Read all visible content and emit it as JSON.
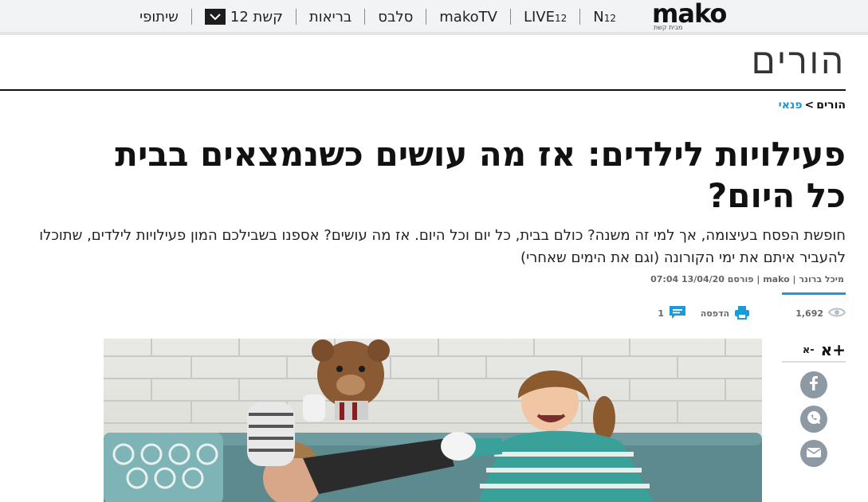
{
  "nav": {
    "logo_text": "mako",
    "logo_sub": "מבית קשת",
    "items": [
      {
        "label": "N",
        "sup": "12"
      },
      {
        "label": "LIVE",
        "sup": "12"
      },
      {
        "label": "makoTV"
      },
      {
        "label": "סלבס"
      },
      {
        "label": "בריאות"
      },
      {
        "label": "קשת 12"
      },
      {
        "label": "שיתופי"
      }
    ]
  },
  "section": {
    "title": "הורים"
  },
  "breadcrumb": {
    "root": "הורים",
    "separator": ">",
    "current": "פנאי"
  },
  "article": {
    "headline": "פעילויות לילדים: אז מה עושים כשנמצאים בבית כל היום?",
    "subtitle": "חופשת הפסח בעיצומה, אך למי זה משנה? כולם בבית, כל יום וכל היום. אז מה עושים? אספנו בשבילכם המון פעילויות לילדים, שתוכלו להעביר איתם את ימי הקורונה (וגם את הימים שאחרי)",
    "byline": "מיכל ברונר | mako | פורסם 13/04/20 07:04"
  },
  "stats": {
    "views": "1,692",
    "print_label": "הדפסה",
    "comments": "1"
  },
  "tools": {
    "font_decrease": "א-",
    "font_increase": "א+"
  },
  "icons": {
    "views": "eye-icon",
    "print": "printer-icon",
    "comments": "comment-bubble-icon",
    "facebook": "facebook-icon",
    "whatsapp": "whatsapp-icon",
    "email": "email-icon"
  },
  "colors": {
    "accent": "#1a9bd7",
    "share_grey": "#8d99a3",
    "nav_bg": "#f1f3f4"
  }
}
